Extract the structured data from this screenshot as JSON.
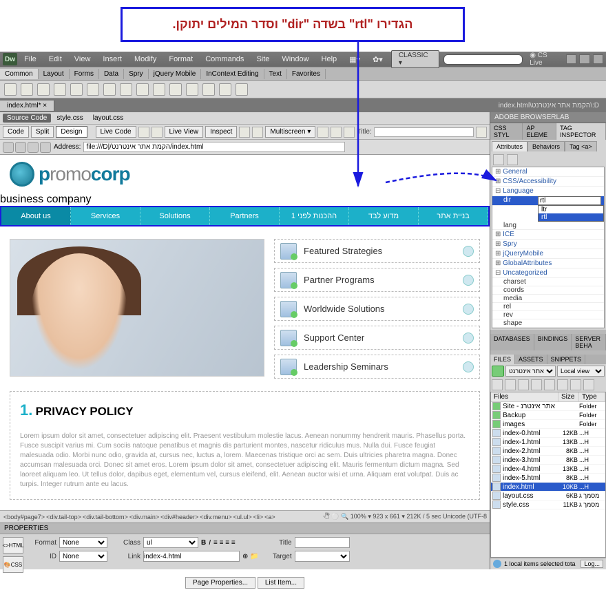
{
  "callout": "הגדירו \"rtl\" בשדה \"dir\" וסדר המילים יתוקן.",
  "menu": [
    "File",
    "Edit",
    "View",
    "Insert",
    "Modify",
    "Format",
    "Commands",
    "Site",
    "Window",
    "Help"
  ],
  "menuRight": {
    "classic": "CLASSIC",
    "cslive": "CS Live"
  },
  "insertTabs": [
    "Common",
    "Layout",
    "Forms",
    "Data",
    "Spry",
    "jQuery Mobile",
    "InContext Editing",
    "Text",
    "Favorites"
  ],
  "docTab": {
    "name": "index.html*",
    "path": "D:\\הקמת אתר אינטרנט\\index.html"
  },
  "srcBar": {
    "source": "Source Code",
    "files": [
      "style.css",
      "layout.css"
    ]
  },
  "viewBar": {
    "code": "Code",
    "split": "Split",
    "design": "Design",
    "liveCode": "Live Code",
    "liveView": "Live View",
    "inspect": "Inspect",
    "multiscreen": "Multiscreen",
    "titleLabel": "Title:",
    "title": ""
  },
  "addr": {
    "label": "Address:",
    "value": "file:///D|/הקמת אתר אינטרנט/index.html"
  },
  "site": {
    "logo1": "p",
    "logo2": "romo",
    "logo3": "corp",
    "logoSub": "business company",
    "nav": [
      "About us",
      "Services",
      "Solutions",
      "Partners",
      "1 ההכנות לפני",
      "מדוע לבד",
      "בניית אתר"
    ],
    "features": [
      "Featured Strategies",
      "Partner Programs",
      "Worldwide Solutions",
      "Support Center",
      "Leadership Seminars"
    ],
    "privacyNum": "1.",
    "privacyTitle": "PRIVACY POLICY",
    "privacyBody": "Lorem ipsum dolor sit amet, consectetuer adipiscing elit. Praesent vestibulum molestie lacus. Aenean nonummy hendrerit mauris. Phasellus porta. Fusce suscipit varius mi. Cum sociis natoque penatibus et magnis dis parturient montes, nascetur ridiculus mus. Nulla dui. Fusce feugiat malesuada odio. Morbi nunc odio, gravida at, cursus nec, luctus a, lorem. Maecenas tristique orci ac sem. Duis ultricies pharetra magna. Donec accumsan malesuada orci. Donec sit amet eros. Lorem ipsum dolor sit amet, consectetuer adipiscing elit. Mauris fermentum dictum magna. Sed laoreet aliquam leo. Ut tellus dolor, dapibus eget, elementum vel, cursus eleifend, elit. Aenean auctor wisi et urna. Aliquam erat volutpat. Duis ac turpis. Integer rutrum ante eu lacus."
  },
  "status": {
    "tags": [
      "<body#page7>",
      "<div.tail-top>",
      "<div.tail-bottom>",
      "<div.main>",
      "<div#header>",
      "<div.menu>",
      "<ul.ul>",
      "<li>",
      "<a>"
    ],
    "zoom": "100%",
    "dims": "923 x 661",
    "size": "212K / 5 sec",
    "enc": "Unicode (UTF-8"
  },
  "props": {
    "header": "PROPERTIES",
    "htmlBtn": "HTML",
    "cssBtn": "CSS",
    "formatLabel": "Format",
    "format": "None",
    "idLabel": "ID",
    "id": "None",
    "classLabel": "Class",
    "class": "ul",
    "linkLabel": "Link",
    "link": "index-4.html",
    "titleLabel": "Title",
    "title": "",
    "targetLabel": "Target",
    "target": "",
    "pageProps": "Page Properties...",
    "listItem": "List Item..."
  },
  "inspector": {
    "browserlab": "ADOBE BROWSERLAB",
    "topTabs": [
      "CSS STYL",
      "AP ELEME",
      "TAG INSPECTOR"
    ],
    "subTabs": [
      "Attributes",
      "Behaviors",
      "Tag <a>"
    ],
    "cats": [
      "General",
      "CSS/Accessibility",
      "Language",
      "ICE",
      "Spry",
      "jQueryMobile",
      "GlobalAttributes",
      "Uncategorized"
    ],
    "langAttrs": {
      "dir": "rtl",
      "lang": ""
    },
    "dirOptions": [
      "ltr",
      "rtl"
    ],
    "uncat": [
      "charset",
      "coords",
      "media",
      "rel",
      "rev",
      "shape"
    ]
  },
  "dbPanel": {
    "tabs": [
      "DATABASES",
      "BINDINGS",
      "SERVER BEHA"
    ]
  },
  "filesPanel": {
    "tabs": [
      "FILES",
      "ASSETS",
      "SNIPPETS"
    ],
    "site": "אתר אינטרנט",
    "view": "Local view",
    "cols": [
      "Files",
      "Size",
      "Type"
    ],
    "root": "Site - הקמת אתר אינטרנ...",
    "rows": [
      {
        "n": "Backup",
        "s": "",
        "t": "Folder",
        "f": true
      },
      {
        "n": "images",
        "s": "",
        "t": "Folder",
        "f": true
      },
      {
        "n": "index-0.html",
        "s": "12KB",
        "t": "...H"
      },
      {
        "n": "index-1.html",
        "s": "13KB",
        "t": "...H"
      },
      {
        "n": "index-2.html",
        "s": "8KB",
        "t": "...H"
      },
      {
        "n": "index-3.html",
        "s": "8KB",
        "t": "...H"
      },
      {
        "n": "index-4.html",
        "s": "13KB",
        "t": "...H"
      },
      {
        "n": "index-5.html",
        "s": "8KB",
        "t": "...H"
      },
      {
        "n": "index.html",
        "s": "10KB",
        "t": "...H",
        "sel": true
      },
      {
        "n": "layout.css",
        "s": "6KB",
        "t": "מסמך ג"
      },
      {
        "n": "style.css",
        "s": "11KB",
        "t": "מסמך ג"
      }
    ],
    "status": "1 local items selected tota",
    "log": "Log..."
  }
}
